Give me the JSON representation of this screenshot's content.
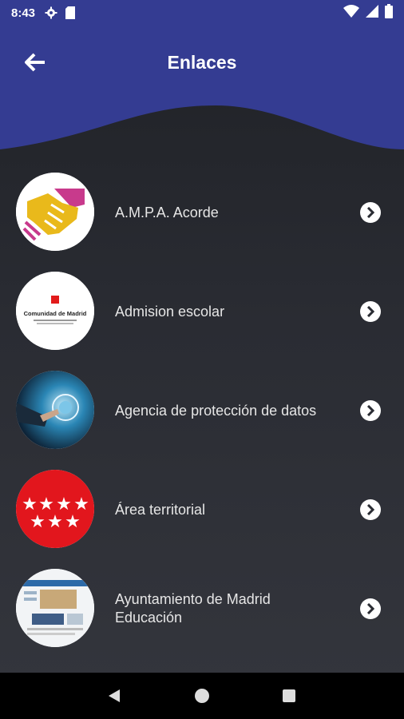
{
  "status_bar": {
    "time": "8:43",
    "left_icons": [
      "gear-icon",
      "sd-card-icon"
    ],
    "right_icons": [
      "wifi-icon",
      "signal-icon",
      "battery-icon"
    ]
  },
  "header": {
    "title": "Enlaces",
    "back_icon": "arrow-left-icon",
    "color": "#343c92"
  },
  "links": [
    {
      "label": "A.M.P.A. Acorde",
      "icon": "handshake-logo"
    },
    {
      "label": "Admision escolar",
      "icon": "comunidad-de-madrid-logo",
      "logo_text": "Comunidad de Madrid"
    },
    {
      "label": "Agencia de protección de datos",
      "icon": "data-protection-photo"
    },
    {
      "label": "Área territorial",
      "icon": "madrid-flag-stars"
    },
    {
      "label": "Ayuntamiento de Madrid\nEducación",
      "icon": "website-screenshot"
    }
  ],
  "nav_bar": {
    "buttons": [
      "back-triangle-icon",
      "home-circle-icon",
      "recents-square-icon"
    ]
  }
}
